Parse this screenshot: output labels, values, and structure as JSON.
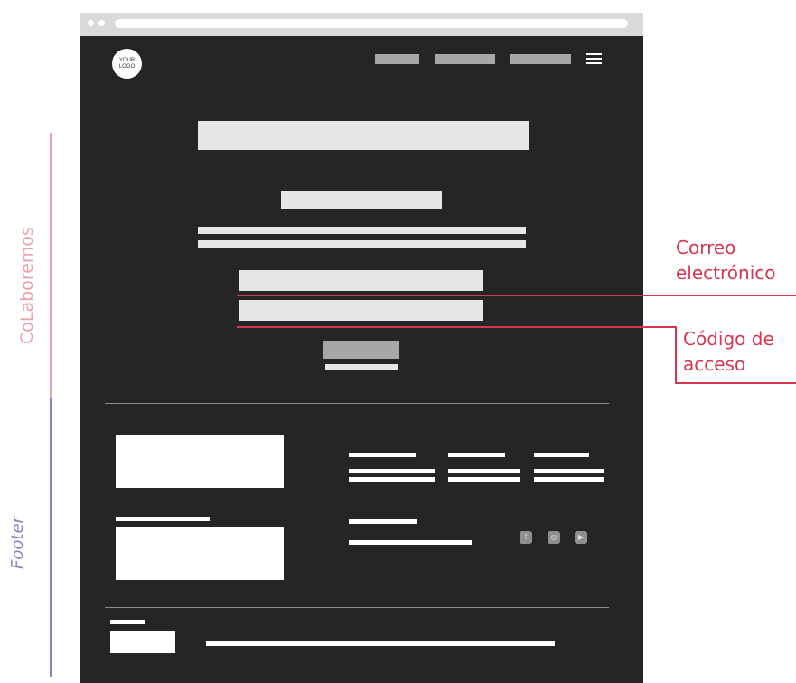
{
  "sections": {
    "colaboremos": "CoLaboremos",
    "footer": "Footer"
  },
  "header": {
    "logo": "YOUR\nLOGO"
  },
  "annotations": {
    "email": "Correo\nelectrónico",
    "code": "Código de\nacceso"
  },
  "social": {
    "facebook": "f",
    "instagram": "◎",
    "youtube": "▶"
  },
  "colors": {
    "accent_red": "#d6364f",
    "accent_pink": "#e8a5ad",
    "accent_purple": "#8b7fc0",
    "frame_dark": "#252525"
  }
}
